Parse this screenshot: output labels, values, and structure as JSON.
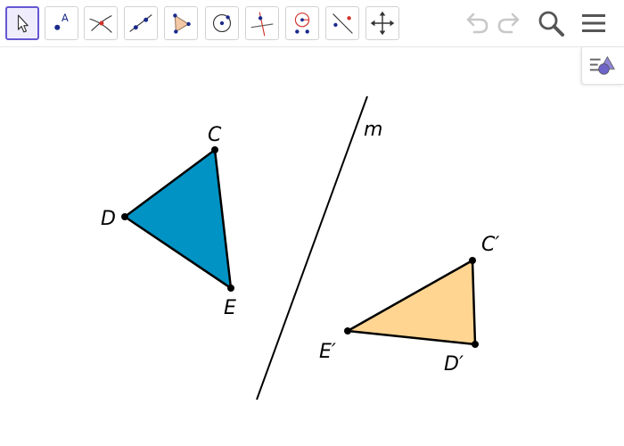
{
  "toolbar": {
    "tools": [
      {
        "name": "Move",
        "icon": "move-arrow-icon",
        "selected": true
      },
      {
        "name": "Point",
        "icon": "point-icon",
        "label": "A"
      },
      {
        "name": "Intersect",
        "icon": "intersect-icon"
      },
      {
        "name": "Line",
        "icon": "line-icon"
      },
      {
        "name": "Polygon",
        "icon": "polygon-icon"
      },
      {
        "name": "Circle with Center",
        "icon": "circle-icon"
      },
      {
        "name": "Perpendicular Line",
        "icon": "perpendicular-line-icon"
      },
      {
        "name": "Reflect about Line",
        "icon": "reflect-icon"
      },
      {
        "name": "Slope / Line tools",
        "icon": "line-tools-icon"
      },
      {
        "name": "Move Graphics View",
        "icon": "move-view-icon"
      }
    ],
    "actions": [
      {
        "name": "Undo",
        "icon": "undo-icon",
        "enabled": false
      },
      {
        "name": "Redo",
        "icon": "redo-icon",
        "enabled": false
      },
      {
        "name": "Search",
        "icon": "search-icon"
      },
      {
        "name": "Menu",
        "icon": "hamburger-menu-icon"
      }
    ],
    "style_bar_icon": "style-bar-icon"
  },
  "colors": {
    "accent": "#6557d2",
    "triangle_original": "#0093c4",
    "triangle_image": "#ffd591",
    "stroke": "#000000",
    "icon_point_blue": "#1a2a8c",
    "icon_red": "#d0322a",
    "icon_gray": "#5a5a5a"
  },
  "construction": {
    "line_label": "m",
    "original_triangle": {
      "vertices": [
        {
          "label": "C"
        },
        {
          "label": "D"
        },
        {
          "label": "E"
        }
      ]
    },
    "reflected_triangle": {
      "vertices": [
        {
          "label": "C′"
        },
        {
          "label": "E′"
        },
        {
          "label": "D′"
        }
      ]
    }
  }
}
